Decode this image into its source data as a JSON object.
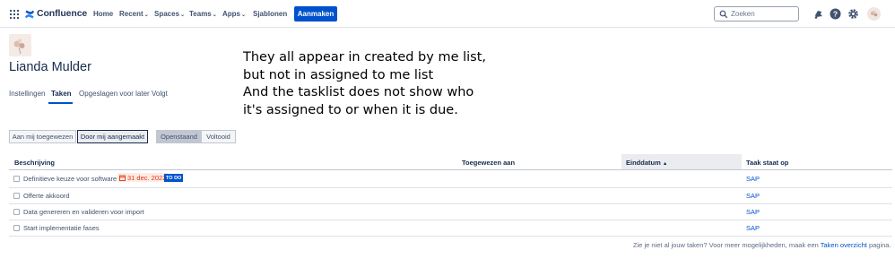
{
  "nav": {
    "logo": "Confluence",
    "items": [
      {
        "label": "Home",
        "has_chevron": false
      },
      {
        "label": "Recent",
        "has_chevron": true
      },
      {
        "label": "Spaces",
        "has_chevron": true
      },
      {
        "label": "Teams",
        "has_chevron": true
      },
      {
        "label": "Apps",
        "has_chevron": true
      },
      {
        "label": "Sjablonen",
        "has_chevron": false
      }
    ],
    "create_label": "Aanmaken",
    "search_placeholder": "Zoeken",
    "icons": [
      "notification-icon",
      "help-icon",
      "settings-icon",
      "avatar"
    ]
  },
  "profile": {
    "name": "Lianda Mulder",
    "tabs": [
      "Instellingen",
      "Taken",
      "Opgeslagen voor later",
      "Volgt"
    ],
    "active_tab": "Taken"
  },
  "annotation": {
    "lines": [
      "They all appear in created by me list,",
      "but not in assigned to me list",
      "And the tasklist does not show who",
      "it's assigned to or when it is due."
    ]
  },
  "filters": {
    "assigned": "Aan mij toegewezen",
    "created": "Door mij aangemaakt",
    "open": "Openstaand",
    "done": "Voltooid",
    "selected": "Door mij aangemaakt",
    "status_selected": "Openstaand"
  },
  "table": {
    "headers": {
      "description": "Beschrijving",
      "assigned": "Toegewezen aan",
      "due": "Einddatum",
      "due_sort": "▲",
      "space": "Taak staat op"
    },
    "rows": [
      {
        "text": "Definitieve keuze voor software",
        "date": "31 dec. 2022",
        "status": "TO DO",
        "space": "SAP"
      },
      {
        "text": "Offerte akkoord",
        "date": "",
        "status": "",
        "space": "SAP"
      },
      {
        "text": "Data genereren en valideren voor import",
        "date": "",
        "status": "",
        "space": "SAP"
      },
      {
        "text": "Start implementatie fases",
        "date": "",
        "status": "",
        "space": "SAP"
      }
    ]
  },
  "footer": {
    "prefix": "Zie je niet al jouw taken? Voor meer mogelijkheden, maak een",
    "link": "Taken overzicht",
    "suffix": "pagina."
  },
  "colors": {
    "brand": "#0052cc",
    "text": "#172b4d",
    "overdue": "#de350b"
  }
}
